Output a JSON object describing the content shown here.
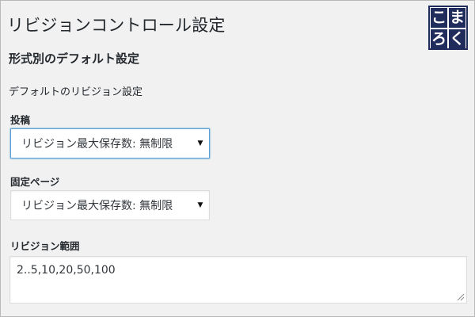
{
  "page": {
    "title": "リビジョンコントロール設定"
  },
  "logo": {
    "chars": [
      "こ",
      "ま",
      "ろ",
      "く"
    ],
    "color": "#1f2c5c"
  },
  "section": {
    "heading": "形式別のデフォルト設定",
    "sub_heading": "デフォルトのリビジョン設定"
  },
  "fields": {
    "post": {
      "label": "投稿",
      "selected": "リビジョン最大保存数: 無制限"
    },
    "page": {
      "label": "固定ページ",
      "selected": "リビジョン最大保存数: 無制限"
    },
    "range": {
      "label": "リビジョン範囲",
      "value": "2..5,10,20,50,100"
    }
  },
  "colors": {
    "background": "#f1f1f1",
    "focus_border": "#5b9dd9",
    "text": "#23282d"
  },
  "icons": {
    "dropdown": "caret-down-icon",
    "resize": "resize-grip-icon"
  }
}
